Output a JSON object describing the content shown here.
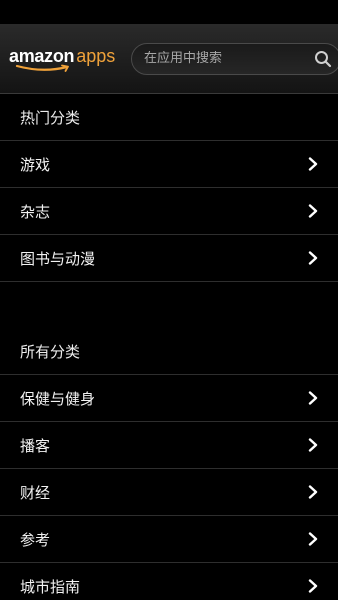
{
  "header": {
    "logo": {
      "brand": "amazon",
      "product": "apps"
    },
    "search": {
      "placeholder": "在应用中搜索",
      "icon": "search-icon"
    }
  },
  "popular_categories": {
    "title": "热门分类",
    "items": [
      {
        "label": "游戏",
        "icon": "chevron-right-icon"
      },
      {
        "label": "杂志",
        "icon": "chevron-right-icon"
      },
      {
        "label": "图书与动漫",
        "icon": "chevron-right-icon"
      }
    ]
  },
  "all_categories": {
    "title": "所有分类",
    "items": [
      {
        "label": "保健与健身",
        "icon": "chevron-right-icon"
      },
      {
        "label": "播客",
        "icon": "chevron-right-icon"
      },
      {
        "label": "财经",
        "icon": "chevron-right-icon"
      },
      {
        "label": "参考",
        "icon": "chevron-right-icon"
      },
      {
        "label": "城市指南",
        "icon": "chevron-right-icon"
      }
    ]
  },
  "colors": {
    "background": "#000000",
    "header_gradient_top": "#2a2a2a",
    "header_gradient_bottom": "#141414",
    "brand_accent": "#f0a23a",
    "divider": "#2e2e2e",
    "text": "#f2f2f2"
  }
}
